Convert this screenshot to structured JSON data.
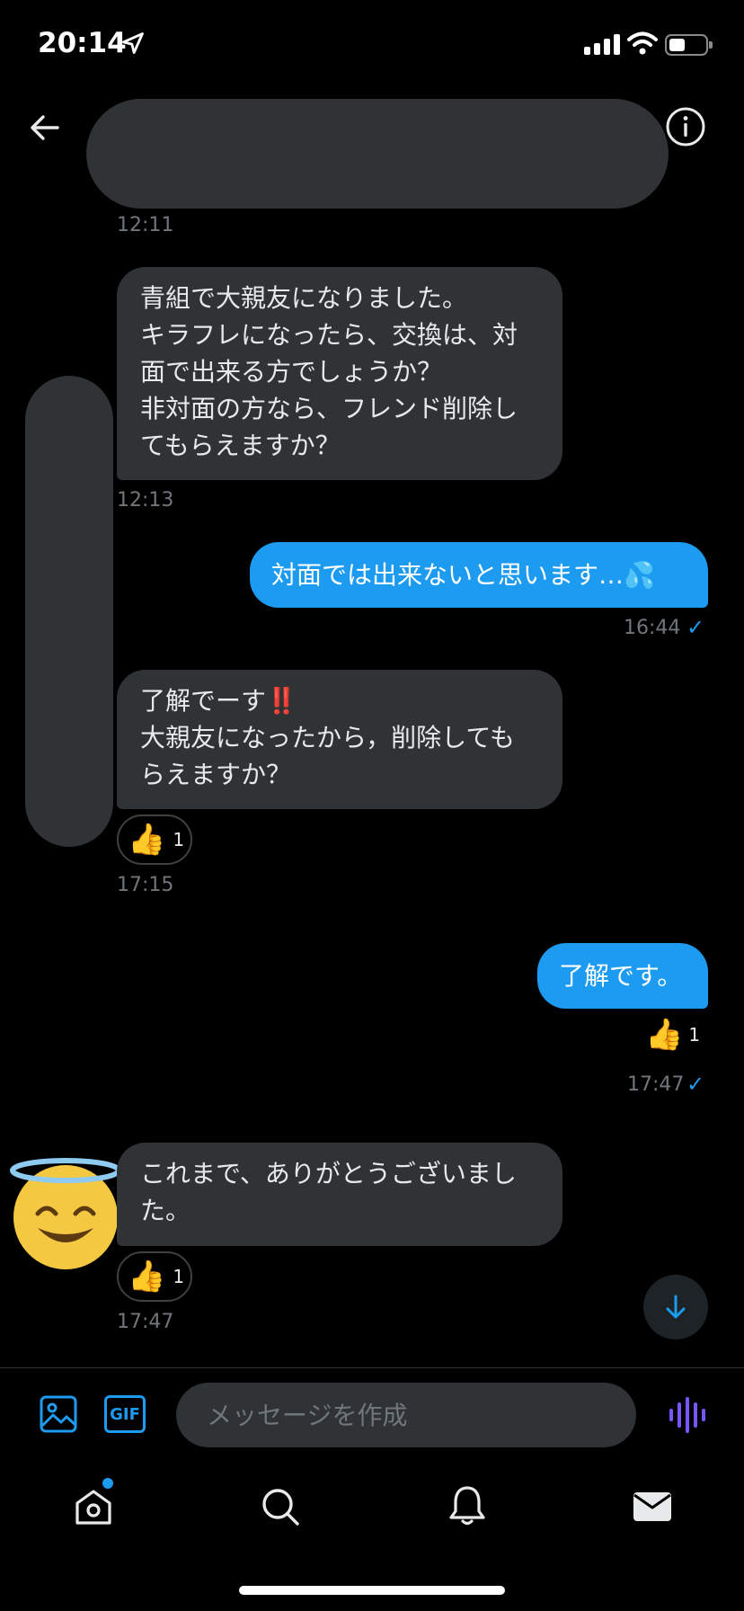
{
  "status_bar": {
    "time": "20:14"
  },
  "messages": {
    "ts_1211": "12:11",
    "msg1_lines": [
      "青組で大親友になりました。",
      "キラフレになったら、交換は、対",
      "面で出来る方でしょうか？",
      "非対面の方なら、フレンド削除し",
      "てもらえますか？"
    ],
    "ts_1213": "12:13",
    "msg2_text": "対面では出来ないと思います…",
    "msg2_emoji": "💦",
    "ts_1644": "16:44",
    "msg3_line1": "了解でーす",
    "msg3_bangs": "‼️",
    "msg3_line2": "大親友になったから，削除しても",
    "msg3_line3": "らえますか？",
    "react1_count": "1",
    "ts_1715": "17:15",
    "msg4_text": "了解です。",
    "react2_count": "1",
    "ts_1747a": "17:47",
    "msg5_line1": "これまで、ありがとうございまし",
    "msg5_line2": "た。",
    "react3_count": "1",
    "ts_1747b": "17:47"
  },
  "composer": {
    "placeholder": "メッセージを作成",
    "gif_label": "GIF"
  },
  "icons": {
    "back": "back-arrow-icon",
    "info": "info-icon",
    "media": "image-icon",
    "gif": "gif-icon",
    "voice": "voice-wave-icon",
    "scroll": "arrow-down-icon",
    "home": "home-icon",
    "search": "search-icon",
    "notifications": "bell-icon",
    "messages": "mail-icon",
    "reaction": "thumbs-up-emoji",
    "read_receipt": "check-icon"
  },
  "colors": {
    "accent": "#1d9bf0",
    "bubble_in": "#2f3336",
    "background": "#000000",
    "voice": "#7856ff"
  }
}
